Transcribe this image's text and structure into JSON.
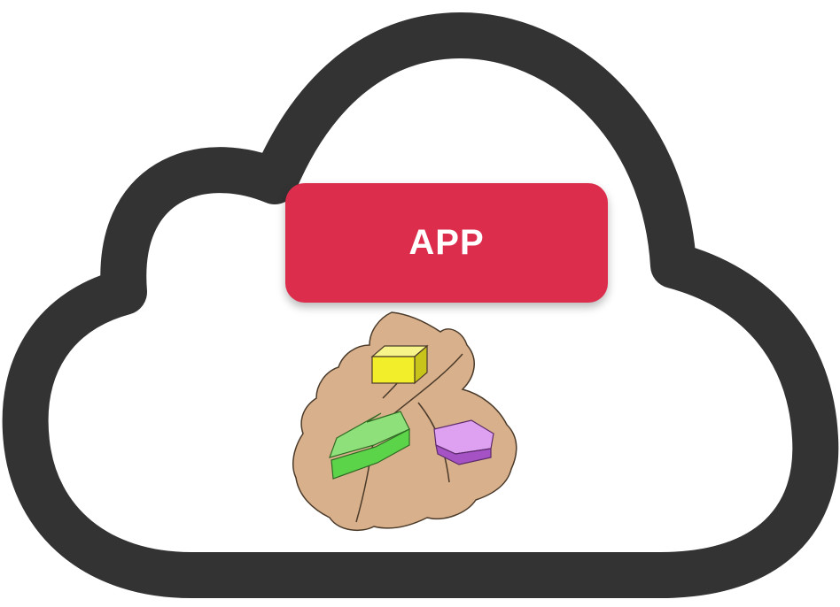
{
  "badge": {
    "label": "APP",
    "color": "#dc2d4d"
  },
  "cloud": {
    "icon": "cloud-outline-icon",
    "stroke_color": "#333333"
  },
  "logo": {
    "icon": "leaf-with-shapes-icon",
    "leaf_color": "#d9b08c",
    "shape_colors": {
      "cube": "#f2ee2a",
      "green_arrow": "#5cd44a",
      "purple_pentagon": "#c87ae0"
    }
  }
}
